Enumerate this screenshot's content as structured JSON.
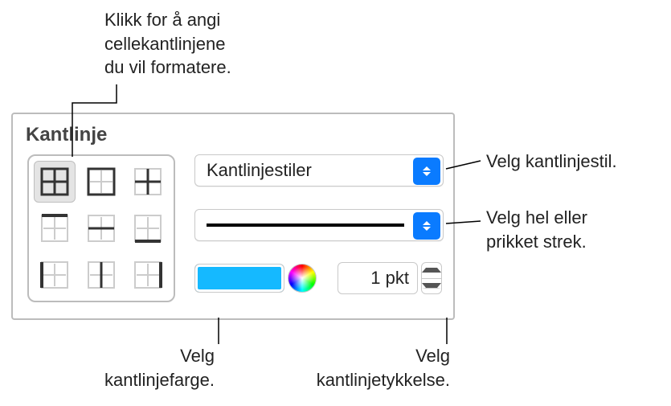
{
  "annotations": {
    "grid_help": "Klikk for å angi\ncellekantlinjene\ndu vil formatere.",
    "style_help": "Velg kantlinjestil.",
    "stroke_help": "Velg hel eller\nprikket strek.",
    "color_help": "Velg\nkantlinjefarge.",
    "thickness_help": "Velg\nkantlinjetykkelse."
  },
  "panel": {
    "section_title": "Kantlinje",
    "style_popup_label": "Kantlinjestiler",
    "thickness_value": "1 pkt",
    "selected_color": "#15b9ff",
    "grid": [
      {
        "name": "border-all-icon",
        "selected": true
      },
      {
        "name": "border-outer-icon",
        "selected": false
      },
      {
        "name": "border-inner-icon",
        "selected": false
      },
      {
        "name": "border-top-icon",
        "selected": false
      },
      {
        "name": "border-hcenter-icon",
        "selected": false
      },
      {
        "name": "border-bottom-icon",
        "selected": false
      },
      {
        "name": "border-left-icon",
        "selected": false
      },
      {
        "name": "border-vcenter-icon",
        "selected": false
      },
      {
        "name": "border-right-icon",
        "selected": false
      }
    ]
  }
}
